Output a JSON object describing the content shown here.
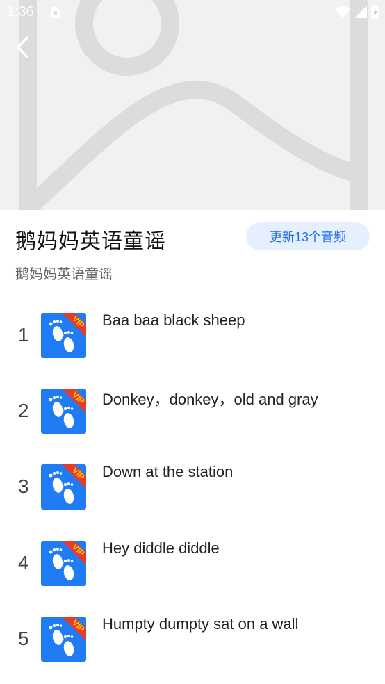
{
  "status_bar": {
    "time": "1:36"
  },
  "album": {
    "title": "鹅妈妈英语童谣",
    "subtitle": "鹅妈妈英语童谣",
    "update_label": "更新13个音频"
  },
  "badge_text": "VIP",
  "colors": {
    "accent": "#1e6fe8",
    "pill_bg": "#e5effd",
    "thumb_bg": "#1f7cf5",
    "ribbon": "#e63a2a",
    "ribbon_text": "#ffd400"
  },
  "tracks": [
    {
      "num": "1",
      "title": "Baa baa black sheep"
    },
    {
      "num": "2",
      "title": "Donkey，donkey，old and gray"
    },
    {
      "num": "3",
      "title": "Down at the station"
    },
    {
      "num": "4",
      "title": "Hey diddle diddle"
    },
    {
      "num": "5",
      "title": "Humpty dumpty sat on a wall"
    }
  ]
}
